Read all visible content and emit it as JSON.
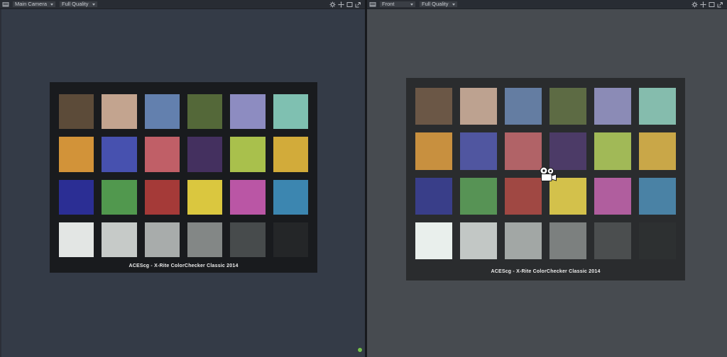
{
  "left_viewport": {
    "camera_select": "Main Camera",
    "quality_select": "Full Quality",
    "background": "#343b47",
    "chart": {
      "caption": "ACEScg - X-Rite ColorChecker Classic 2014",
      "frame_color": "#191b1e",
      "rows": 4,
      "cols": 6,
      "swatch_colors": [
        "#5c4b39",
        "#c3a48f",
        "#6380ae",
        "#546839",
        "#8d8cc1",
        "#7fc0b1",
        "#d29339",
        "#4751af",
        "#c05f67",
        "#44305f",
        "#a9c04c",
        "#d2ab3a",
        "#2b2e94",
        "#51984e",
        "#a53a38",
        "#dac73f",
        "#ba56a5",
        "#3c86b0",
        "#e3e6e4",
        "#c6cac8",
        "#a8acab",
        "#838786",
        "#474b4c",
        "#242628"
      ]
    }
  },
  "right_viewport": {
    "camera_select": "Front",
    "quality_select": "Full Quality",
    "background": "#474b50",
    "chart": {
      "caption": "ACEScg - X-Rite ColorChecker Classic 2014",
      "frame_color": "#2a2c2e",
      "rows": 4,
      "cols": 6,
      "swatch_colors": [
        "#6b5746",
        "#bda290",
        "#647da2",
        "#5d6b44",
        "#8b8bb6",
        "#85bcad",
        "#c8903f",
        "#5056a0",
        "#b16367",
        "#4c3b67",
        "#a1b957",
        "#c9a748",
        "#393e89",
        "#579355",
        "#a04843",
        "#d3c14b",
        "#b05e9e",
        "#4a82a5",
        "#e9efec",
        "#c2c7c5",
        "#a2a7a5",
        "#7c807f",
        "#4b4e4f",
        "#2d3031"
      ]
    },
    "cursor_icon": "movie-camera-cursor"
  },
  "header_icons": [
    "viewport-menu-icon",
    "gear-icon",
    "pan-icon",
    "frame-icon",
    "maximize-icon"
  ],
  "status": {
    "indicator_color": "#76c14e"
  }
}
